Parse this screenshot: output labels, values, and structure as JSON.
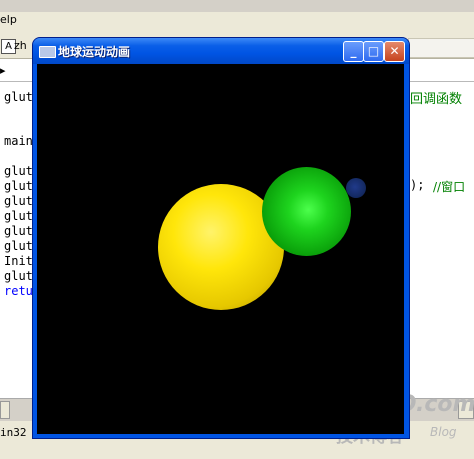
{
  "ide": {
    "menu_help": "elp",
    "file_combo": "zh",
    "code_lines": [
      {
        "text": "glut",
        "kind": "code"
      },
      {
        "text": "main",
        "kind": "code"
      },
      {
        "text": "glut",
        "kind": "code"
      },
      {
        "text": "glut",
        "kind": "code"
      },
      {
        "text": "glut",
        "kind": "code"
      },
      {
        "text": "glut",
        "kind": "code"
      },
      {
        "text": "glut",
        "kind": "code"
      },
      {
        "text": "glut",
        "kind": "code"
      },
      {
        "text": "Init",
        "kind": "code"
      },
      {
        "text": "glut",
        "kind": "code"
      },
      {
        "text": "retu",
        "kind": "keyword"
      }
    ],
    "right_comment_1": "回调函数",
    "right_code_2": ");",
    "right_comment_2": "//窗口",
    "status_text": "in32"
  },
  "gl_window": {
    "title": "地球运动动画",
    "buttons": {
      "minimize": "_",
      "maximize": "□",
      "close": "✕"
    }
  },
  "scene": {
    "bodies": [
      {
        "name": "sun",
        "color": "#ffe60a"
      },
      {
        "name": "earth",
        "color": "#1ed41e"
      },
      {
        "name": "moon",
        "color": "#13285e"
      }
    ],
    "background": "#000000"
  },
  "watermark": {
    "main": "51CTO.com",
    "sub": "技术博客",
    "blog": "Blog"
  }
}
